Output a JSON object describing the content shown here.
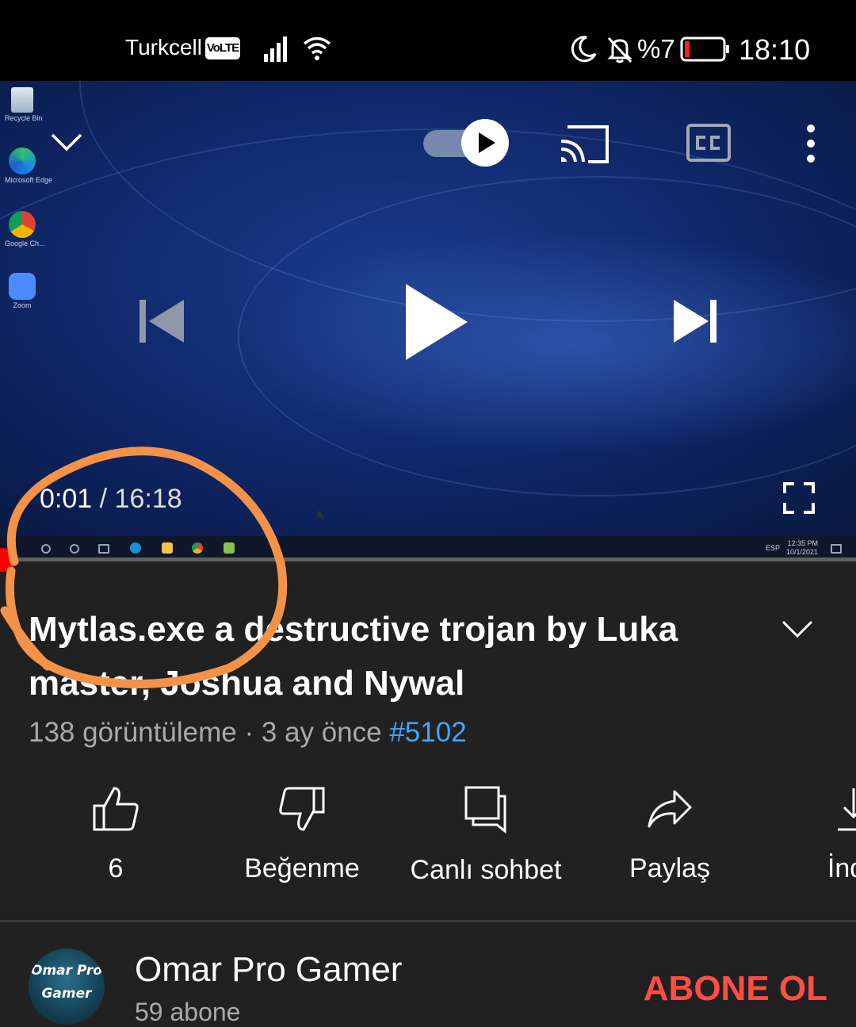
{
  "status_bar": {
    "carrier": "Turkcell",
    "network_badge": "VoLTE",
    "battery_percent": "%7",
    "time": "18:10",
    "icons": [
      "signal-icon",
      "wifi-icon",
      "moon-icon",
      "bell-off-icon",
      "battery-low-icon"
    ]
  },
  "player": {
    "current_time": "0:01",
    "separator": "/",
    "duration": "16:18",
    "progress_fraction": 0.001,
    "autoplay": "on",
    "desktop": {
      "icons": [
        {
          "label": "Recycle Bin"
        },
        {
          "label": "Microsoft Edge"
        },
        {
          "label": "Google Ch..."
        },
        {
          "label": "Zoom"
        }
      ],
      "taskbar_lang": "ESP",
      "taskbar_time": "12:35 PM",
      "taskbar_date": "10/1/2021"
    }
  },
  "video": {
    "title": "Mytlas.exe a destructive trojan by Luka master, Joshua and Nywal",
    "views": "138 görüntüleme",
    "dot": "·",
    "age": "3 ay önce",
    "hashtag": "#5102"
  },
  "actions": [
    {
      "label": "6",
      "icon": "thumbs-up-icon"
    },
    {
      "label": "Beğenme",
      "icon": "thumbs-down-icon"
    },
    {
      "label": "Canlı sohbet",
      "icon": "chat-icon"
    },
    {
      "label": "Paylaş",
      "icon": "share-icon"
    },
    {
      "label": "İndir",
      "icon": "download-icon"
    }
  ],
  "channel": {
    "name": "Omar Pro Gamer",
    "subscribers": "59 abone",
    "avatar_text_line1": "Omar Pro",
    "avatar_text_line2": "Gamer",
    "subscribe_label": "ABONE OL"
  },
  "colors": {
    "accent_red": "#ff0000",
    "subscribe_red": "#ff4e45",
    "hashtag_blue": "#3ea6ff",
    "annotation_orange": "#f4924a",
    "background": "#212121"
  }
}
